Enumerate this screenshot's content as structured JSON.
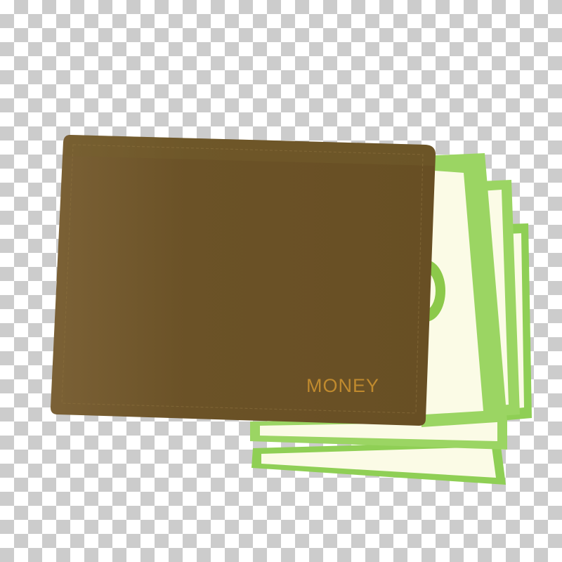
{
  "image": {
    "subject": "wallet-with-banknotes",
    "background": "transparency-checkerboard"
  },
  "wallet": {
    "label": "MONEY"
  },
  "colors": {
    "wallet_brown": "#6b5227",
    "wallet_highlight": "#7b6136",
    "wallet_stitch": "#8a6f3e",
    "label_text": "#c08a2e",
    "note_green": "#9bd563",
    "note_green_dark": "#7cbf3c",
    "note_inner": "#fbfbe6",
    "checker_light": "#ffffff",
    "checker_dark": "#cccccc"
  }
}
